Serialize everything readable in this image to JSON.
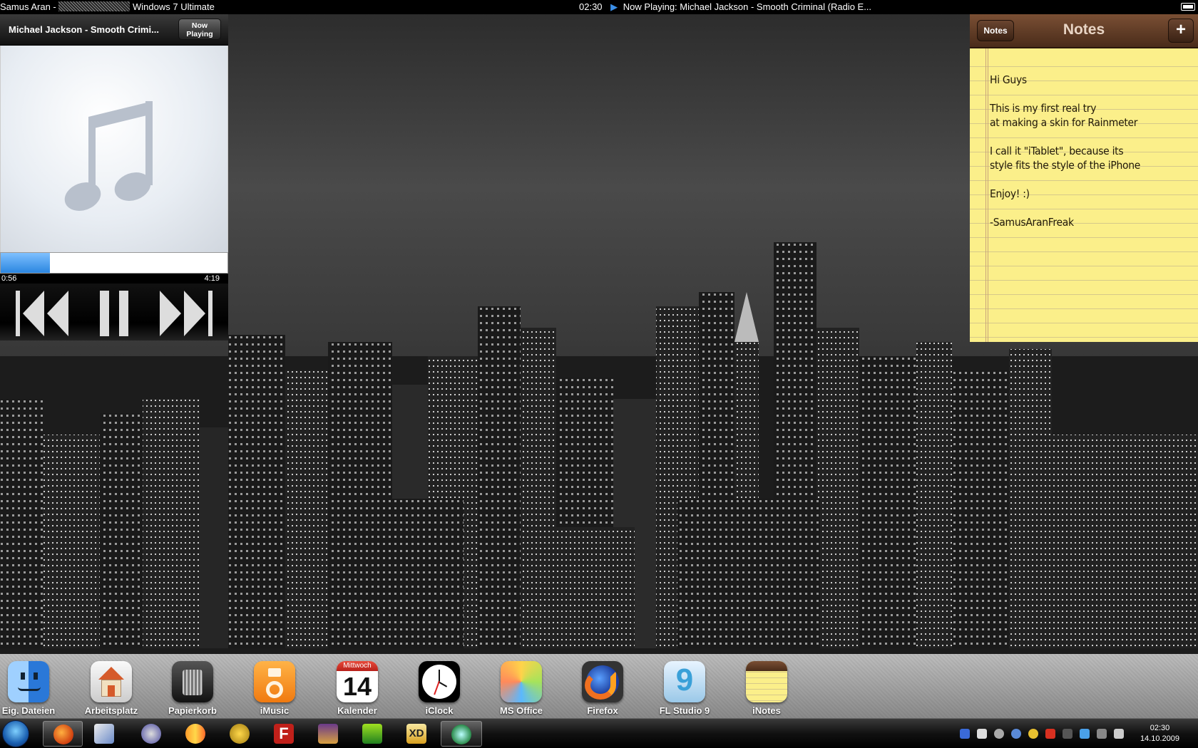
{
  "topbar": {
    "user": "Samus Aran -",
    "os": "Windows 7 Ultimate",
    "time": "02:30",
    "now_playing": "Now Playing: Michael Jackson - Smooth Criminal (Radio E..."
  },
  "music": {
    "title": "Michael Jackson - Smooth Crimi...",
    "now_playing_btn": "Now\nPlaying",
    "current_time": "0:56",
    "total_time": "4:19",
    "progress_fraction": 0.216
  },
  "notes": {
    "back_label": "Notes",
    "title": "Notes",
    "add_label": "+",
    "content": "Hi Guys\n\nThis is my first real try\nat making a skin for Rainmeter\n\nI call it \"iTablet\", because its\nstyle fits the style of the iPhone\n\nEnjoy! :)\n\n-SamusAranFreak"
  },
  "dock": {
    "items": [
      {
        "label": "Eig. Dateien",
        "icon": "finder-icon"
      },
      {
        "label": "Arbeitsplatz",
        "icon": "home-icon"
      },
      {
        "label": "Papierkorb",
        "icon": "trash-icon"
      },
      {
        "label": "iMusic",
        "icon": "ipod-icon"
      },
      {
        "label": "Kalender",
        "icon": "calendar-icon",
        "cal_day": "Mittwoch",
        "cal_date": "14"
      },
      {
        "label": "iClock",
        "icon": "clock-icon"
      },
      {
        "label": "MS Office",
        "icon": "photos-icon"
      },
      {
        "label": "Firefox",
        "icon": "firefox-icon"
      },
      {
        "label": "FL Studio 9",
        "icon": "fl-studio-icon"
      },
      {
        "label": "iNotes",
        "icon": "notes-icon"
      }
    ]
  },
  "taskbar": {
    "clock_time": "02:30",
    "clock_date": "14.10.2009"
  },
  "colors": {
    "accent_blue": "#2a86e0",
    "notes_yellow": "#fbef8a",
    "notes_header": "#5a3824"
  }
}
